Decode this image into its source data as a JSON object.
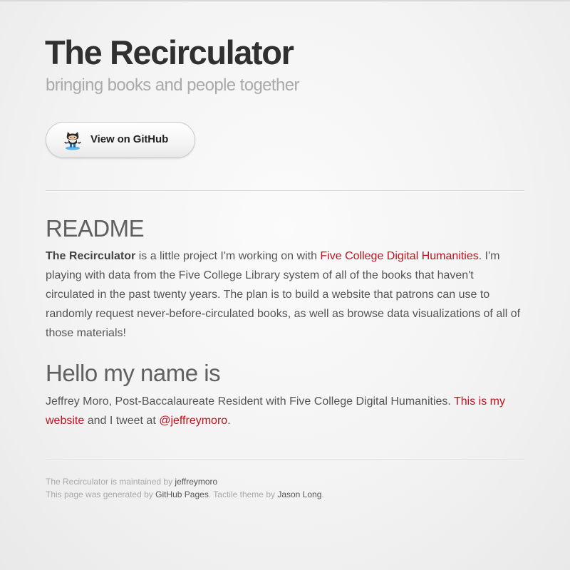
{
  "header": {
    "title": "The Recirculator",
    "tagline": "bringing books and people together",
    "github_button_label": "View on GitHub",
    "github_icon": "octocat-icon"
  },
  "readme": {
    "heading": "README",
    "strong": "The Recirculator",
    "text1": " is a little project I'm working on with ",
    "link_fcdh": "Five College Digital Humanities",
    "text2": ". I'm playing with data from the Five College Library system of all of the books that haven't circulated in the past twenty years. The plan is to build a website that patrons can use to randomly request never-before-circulated books, as well as browse data visualizations of all of those materials!"
  },
  "hello": {
    "heading": "Hello my name is",
    "text1": "Jeffrey Moro, Post-Baccalaureate Resident with Five College Digital Humanities. ",
    "link_website": "This is my website",
    "text2": " and I tweet at ",
    "link_twitter": "@jeffreymoro",
    "text3": "."
  },
  "footer": {
    "line1_prefix": "The Recirculator is maintained by ",
    "maintainer_link": "jeffreymoro",
    "line2_prefix": "This page was generated by ",
    "gh_pages_link": "GitHub Pages",
    "line2_middle": ". Tactile theme by ",
    "theme_author_link": "Jason Long",
    "line2_suffix": "."
  },
  "colors": {
    "link": "#c0111d",
    "title": "#303030",
    "tagline": "#aaaaaa",
    "body_text": "#555555"
  }
}
